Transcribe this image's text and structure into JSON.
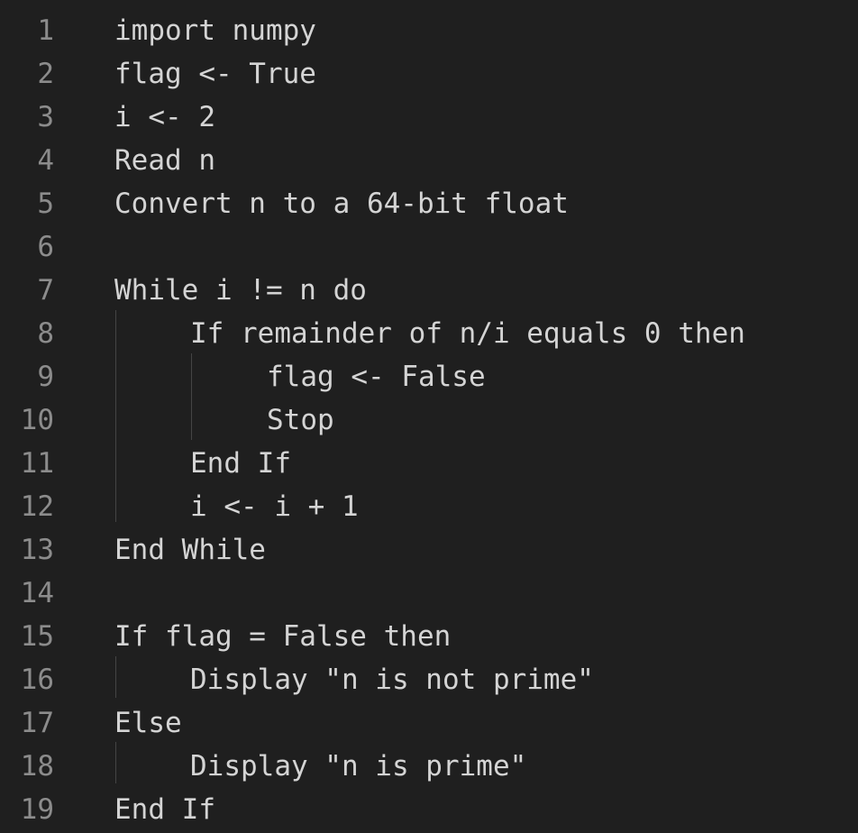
{
  "editor": {
    "lines": [
      {
        "num": "1",
        "text": "import numpy",
        "indent": 0
      },
      {
        "num": "2",
        "text": "flag <- True",
        "indent": 0
      },
      {
        "num": "3",
        "text": "i <- 2",
        "indent": 0
      },
      {
        "num": "4",
        "text": "Read n",
        "indent": 0
      },
      {
        "num": "5",
        "text": "Convert n to a 64-bit float",
        "indent": 0
      },
      {
        "num": "6",
        "text": "",
        "indent": 0
      },
      {
        "num": "7",
        "text": "While i != n do",
        "indent": 0
      },
      {
        "num": "8",
        "text": "If remainder of n/i equals 0 then",
        "indent": 1
      },
      {
        "num": "9",
        "text": "flag <- False",
        "indent": 2
      },
      {
        "num": "10",
        "text": "Stop",
        "indent": 2
      },
      {
        "num": "11",
        "text": "End If",
        "indent": 1
      },
      {
        "num": "12",
        "text": "i <- i + 1",
        "indent": 1
      },
      {
        "num": "13",
        "text": "End While",
        "indent": 0
      },
      {
        "num": "14",
        "text": "",
        "indent": 0
      },
      {
        "num": "15",
        "text": "If flag = False then",
        "indent": 0
      },
      {
        "num": "16",
        "text": "Display \"n is not prime\"",
        "indent": 1
      },
      {
        "num": "17",
        "text": "Else",
        "indent": 0
      },
      {
        "num": "18",
        "text": "Display \"n is prime\"",
        "indent": 1
      },
      {
        "num": "19",
        "text": "End If",
        "indent": 0
      }
    ]
  }
}
